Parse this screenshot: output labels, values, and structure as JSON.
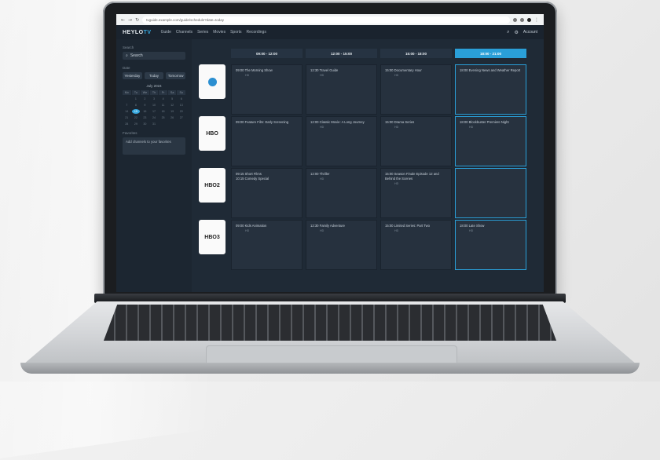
{
  "browser": {
    "url": "tvguide.example.com/guide/schedule?date=today",
    "nav_back": "←",
    "nav_forward": "→",
    "nav_reload": "↻"
  },
  "app": {
    "logo_left": "HEYLO",
    "logo_right": "TV",
    "nav": [
      "Guide",
      "Channels",
      "Series",
      "Movies",
      "Sports",
      "Recordings"
    ],
    "user_label": "Account"
  },
  "sidebar": {
    "search_label": "Search",
    "search_value": "Search",
    "date_label": "Date",
    "buttons": [
      "Yesterday",
      "Today",
      "Tomorrow"
    ],
    "month": "July 2024",
    "weekdays": [
      "Mo",
      "Tu",
      "We",
      "Th",
      "Fr",
      "Sa",
      "Su"
    ],
    "days": [
      "",
      "1",
      "2",
      "3",
      "4",
      "5",
      "6",
      "7",
      "8",
      "9",
      "10",
      "11",
      "12",
      "13",
      "14",
      "15",
      "16",
      "17",
      "18",
      "19",
      "20",
      "21",
      "22",
      "23",
      "24",
      "25",
      "26",
      "27",
      "28",
      "29",
      "30",
      "31",
      "",
      "",
      ""
    ],
    "selected_day": "15",
    "favorites_label": "Favorites",
    "favorites_text": "Add channels to your favorites"
  },
  "columns": [
    "09:00 - 12:00",
    "12:00 - 15:00",
    "15:00 - 18:00",
    "18:00 - 21:00"
  ],
  "active_column": 3,
  "channels": [
    {
      "name": "channel-1",
      "label": ""
    },
    {
      "name": "channel-2",
      "label": "HBO"
    },
    {
      "name": "channel-3",
      "label": "HBO2"
    },
    {
      "name": "channel-4",
      "label": "HBO3"
    }
  ],
  "programs": [
    [
      {
        "title": "09:00 The Morning Show",
        "sub": "HD"
      },
      {
        "title": "12:30 Travel Guide",
        "sub": "HD"
      },
      {
        "title": "15:00 Documentary Hour",
        "sub": "HD"
      },
      {
        "title": "18:00 Evening News and Weather Report",
        "sub": ""
      }
    ],
    [
      {
        "title": "09:00 Feature Film: Early Screening",
        "sub": ""
      },
      {
        "title": "12:00 Classic Movie: A Long Journey",
        "sub": "HD"
      },
      {
        "title": "15:00 Drama Series",
        "sub": "HD"
      },
      {
        "title": "18:00 Blockbuster Premiere Night",
        "sub": "HD"
      }
    ],
    [
      {
        "title": "09:15 Short Films",
        "sub": "",
        "title2": "10:15 Comedy Special"
      },
      {
        "title": "12:00 Thriller",
        "sub": "HD"
      },
      {
        "title": "15:00 Season Finale Episode 12 and Behind the Scenes",
        "sub": "HD"
      },
      {
        "title": "",
        "sub": ""
      }
    ],
    [
      {
        "title": "09:00 Kids Animation",
        "sub": "HD"
      },
      {
        "title": "12:30 Family Adventure",
        "sub": "HD"
      },
      {
        "title": "15:00 Limited Series: Part Two",
        "sub": "HD"
      },
      {
        "title": "18:00 Late Show",
        "sub": "HD"
      }
    ]
  ]
}
